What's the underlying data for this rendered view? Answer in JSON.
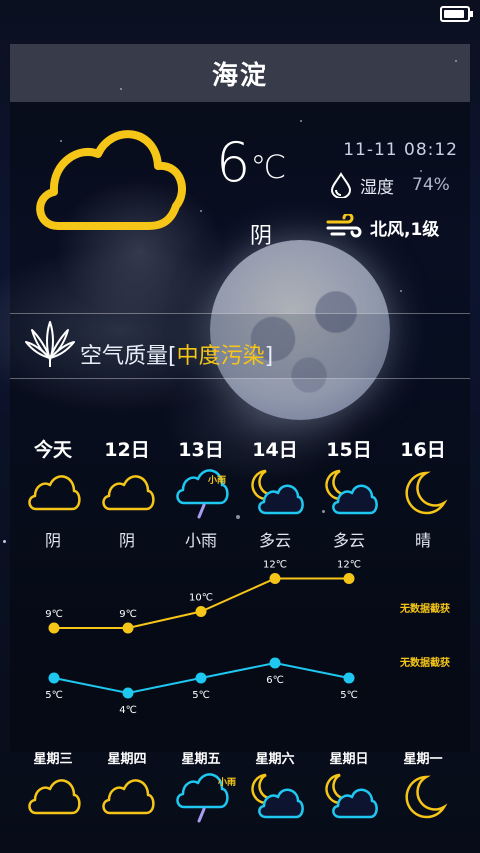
{
  "status_bar": {
    "battery_level": 1.0
  },
  "header": {
    "city": "海淀"
  },
  "current": {
    "temperature": "6",
    "temperature_unit": "℃",
    "condition": "阴",
    "datetime": "11-11  08:12",
    "humidity_label": "湿度",
    "humidity_value": "74%",
    "wind": "北风,1级",
    "icon": "cloud-icon"
  },
  "air_quality": {
    "prefix": "空气质量[",
    "level": "中度污染",
    "suffix": "]",
    "icon": "cannabis-leaf-icon"
  },
  "forecast": [
    {
      "day": "今天",
      "condition": "阴",
      "icon": "cloud-icon",
      "rain_label": ""
    },
    {
      "day": "12日",
      "condition": "阴",
      "icon": "cloud-icon",
      "rain_label": ""
    },
    {
      "day": "13日",
      "condition": "小雨",
      "icon": "rain-cloud-icon",
      "rain_label": "小雨"
    },
    {
      "day": "14日",
      "condition": "多云",
      "icon": "moon-cloud-icon",
      "rain_label": ""
    },
    {
      "day": "15日",
      "condition": "多云",
      "icon": "moon-cloud-icon",
      "rain_label": ""
    },
    {
      "day": "16日",
      "condition": "晴",
      "icon": "moon-icon",
      "rain_label": ""
    }
  ],
  "chart_data": {
    "type": "line",
    "x": [
      "今天",
      "12日",
      "13日",
      "14日",
      "15日",
      "16日"
    ],
    "series": [
      {
        "name": "",
        "color": "#f5c518",
        "values": [
          9,
          9,
          10,
          12,
          12,
          null
        ],
        "labels": [
          "9℃",
          "9℃",
          "10℃",
          "12℃",
          "12℃",
          ""
        ]
      },
      {
        "name": "",
        "color": "#1ec8f0",
        "values": [
          5,
          4,
          5,
          6,
          5,
          null
        ],
        "labels": [
          "5℃",
          "4℃",
          "5℃",
          "6℃",
          "5℃",
          ""
        ]
      }
    ],
    "no_data_text": [
      "无数据截获",
      "无数据截获"
    ]
  },
  "week": [
    {
      "day": "星期三",
      "icon": "cloud-icon",
      "rain_label": ""
    },
    {
      "day": "星期四",
      "icon": "cloud-icon",
      "rain_label": ""
    },
    {
      "day": "星期五",
      "icon": "rain-cloud-icon",
      "rain_label": "小雨"
    },
    {
      "day": "星期六",
      "icon": "moon-cloud-icon",
      "rain_label": ""
    },
    {
      "day": "星期日",
      "icon": "moon-cloud-icon",
      "rain_label": ""
    },
    {
      "day": "星期一",
      "icon": "moon-icon",
      "rain_label": ""
    }
  ],
  "colors": {
    "accent_yellow": "#f5c518",
    "accent_cyan": "#1ec8f0",
    "rain_purple": "#a79cf0"
  }
}
